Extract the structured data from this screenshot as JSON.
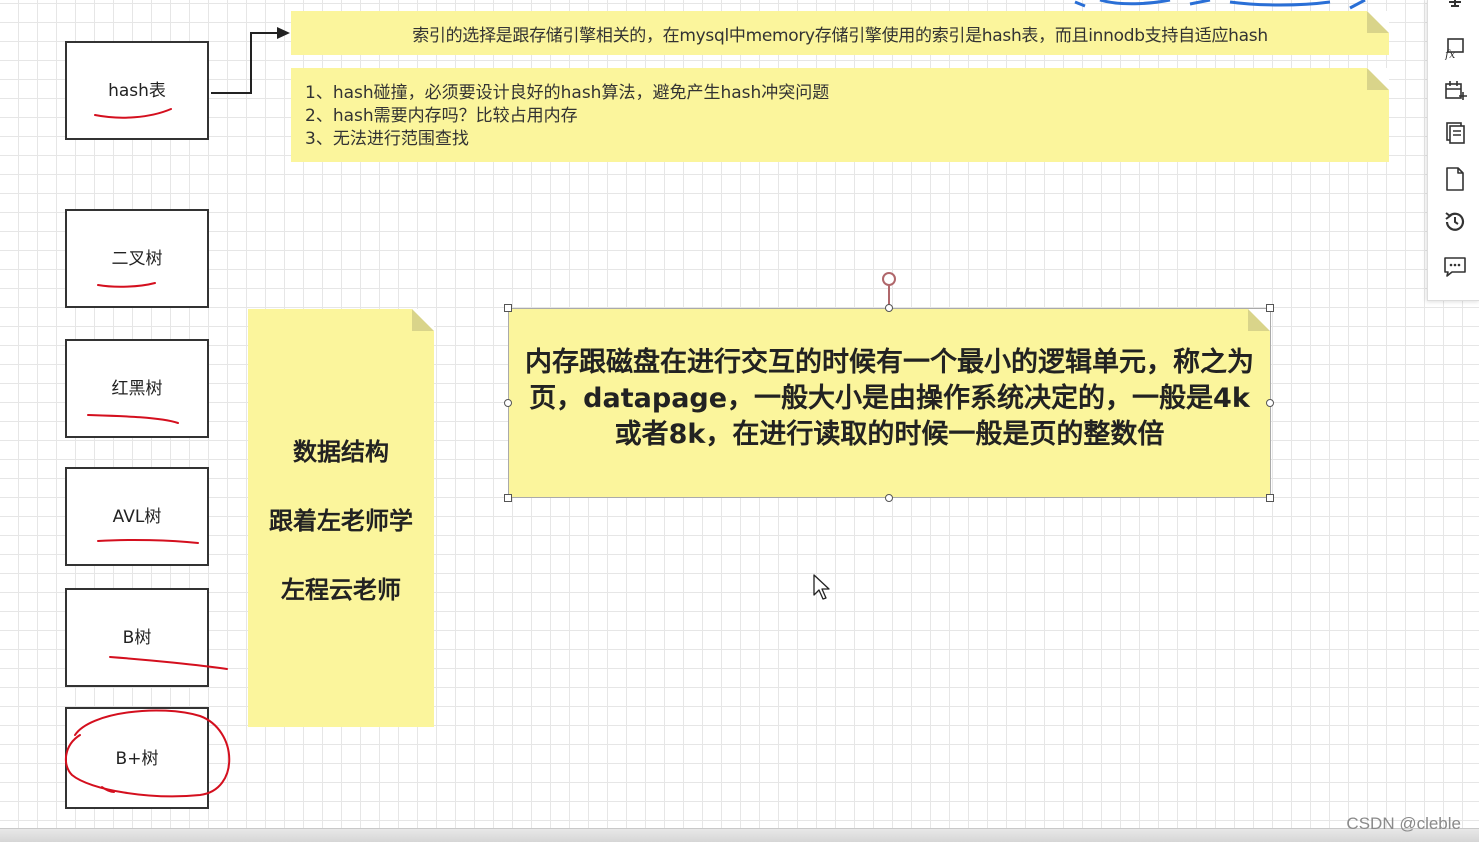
{
  "canvas": {
    "shapes": [
      {
        "label": "hash表"
      },
      {
        "label": "二叉树"
      },
      {
        "label": "红黑树"
      },
      {
        "label": "AVL树"
      },
      {
        "label": "B树"
      },
      {
        "label": "B+树"
      }
    ],
    "notes": {
      "top": "索引的选择是跟存储引擎相关的，在mysql中memory存储引擎使用的索引是hash表，而且innodb支持自适应hash",
      "list": [
        "1、hash碰撞，必须要设计良好的hash算法，避免产生hash冲突问题",
        "2、hash需要内存吗？比较占用内存",
        "3、无法进行范围查找"
      ],
      "side": [
        "数据结构",
        "跟着左老师学",
        "左程云老师"
      ],
      "main": "内存跟磁盘在进行交互的时候有一个最小的逻辑单元，称之为页，datapage，一般大小是由操作系统决定的，一般是4k或者8k，在进行读取的时候一般是页的整数倍"
    },
    "annotation_color": "#d40f1e",
    "note_color": "#fbf59c"
  },
  "toolbar": {
    "items": [
      {
        "icon": "pin-icon"
      },
      {
        "icon": "function-icon"
      },
      {
        "icon": "calendar-add-icon"
      },
      {
        "icon": "copy-icon"
      },
      {
        "icon": "page-icon"
      },
      {
        "icon": "history-icon"
      },
      {
        "icon": "comment-icon"
      }
    ]
  },
  "watermark": "CSDN @cleble"
}
